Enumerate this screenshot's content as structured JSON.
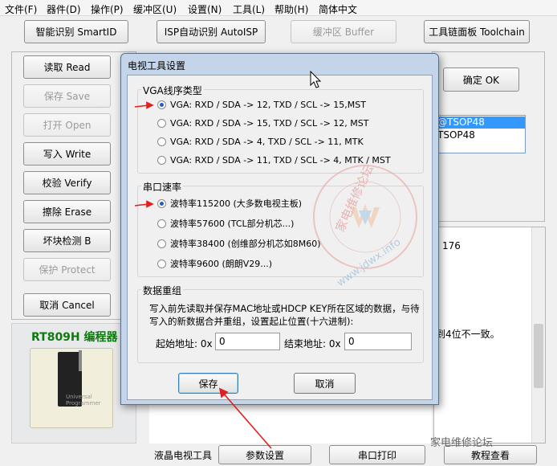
{
  "menu": [
    "文件(F)",
    "器件(D)",
    "操作(P)",
    "缓冲区(U)",
    "设置(N)",
    "工具(L)",
    "帮助(H)",
    "简体中文"
  ],
  "toolbar": {
    "smart_id": "智能识别 SmartID",
    "isp_auto": "ISP自动识别 AutoISP",
    "buffer": "缓冲区 Buffer",
    "toolchain": "工具链面板 Toolchain"
  },
  "actions": {
    "read": "读取 Read",
    "save": "保存 Save",
    "open": "打开 Open",
    "write": "写入 Write",
    "verify": "校验 Verify",
    "erase": "擦除 Erase",
    "blank_check": "坏块检测 B",
    "protect": "保护 Protect",
    "cancel": "取消 Cancel"
  },
  "confirm": "确定 OK",
  "chip_list": [
    "@TSOP48",
    "TSOP48"
  ],
  "photo_title": "RT809H 编程器",
  "prog_label": "Universal Programmer",
  "log": {
    "line1": "176",
    "line2": "到4位不一致。"
  },
  "bottom": {
    "label": "液晶电视工具",
    "params": "参数设置",
    "serial": "串口打印",
    "tutorial": "教程查看"
  },
  "watermark_social": "家电维修论坛",
  "watermark_site": "家电维修论坛",
  "watermark_url": "www.jdwx.info",
  "dialog": {
    "title": "电视工具设置",
    "vga_group": "VGA线序类型",
    "vga_options": [
      "VGA: RXD / SDA -> 12, TXD / SCL -> 15,MST",
      "VGA: RXD / SDA -> 15, TXD / SCL -> 12, MST",
      "VGA: RXD / SDA ->  4, TXD / SCL -> 11, MTK",
      "VGA: RXD / SDA -> 11, TXD / SCL ->  4, MTK / MST"
    ],
    "vga_selected": 0,
    "baud_group": "串口速率",
    "baud_options": [
      "波特率115200 (大多数电视主板)",
      "波特率57600 (TCL部分机芯...)",
      "波特率38400 (创维部分机芯如8M60)",
      "波特率9600 (朗朗V29...)"
    ],
    "baud_selected": 0,
    "data_group": "数据重组",
    "desc_line1": "写入前先读取并保存MAC地址或HDCP KEY所在区域的数据，与待",
    "desc_line2": "写入的新数据合并重组，设置起止位置(十六进制):",
    "start_label": "起始地址: 0x",
    "start_value": "0",
    "end_label": "结束地址: 0x",
    "end_value": "0",
    "save": "保存",
    "cancel": "取消"
  },
  "colors": {
    "arrow": "#e02020",
    "selected": "#3399ff",
    "photo_title": "#0e7a0e"
  }
}
